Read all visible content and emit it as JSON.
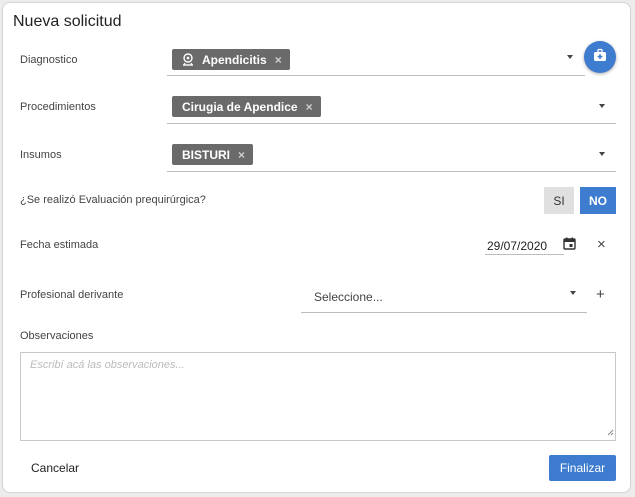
{
  "dialog": {
    "title": "Nueva solicitud"
  },
  "diagnostico": {
    "label": "Diagnostico",
    "chip": "Apendicitis",
    "chip_icon": "person-pin-icon",
    "remove": "×",
    "add_button_icon": "medical-kit-add-icon"
  },
  "procedimientos": {
    "label": "Procedimientos",
    "chip": "Cirugia de Apendice",
    "remove": "×"
  },
  "insumos": {
    "label": "Insumos",
    "chip": "BISTURI",
    "remove": "×"
  },
  "evaluacion": {
    "label": "¿Se realizó Evaluación prequirúrgica?",
    "yes": "SI",
    "no": "NO",
    "selected": "NO"
  },
  "fecha": {
    "label": "Fecha estimada",
    "value": "29/07/2020",
    "clear": "×"
  },
  "profesional": {
    "label": "Profesional derivante",
    "placeholder": "Seleccione...",
    "add": "+"
  },
  "observaciones": {
    "label": "Observaciones",
    "placeholder": "Escribí acá las observaciones..."
  },
  "footer": {
    "cancel": "Cancelar",
    "submit": "Finalizar"
  },
  "colors": {
    "accent": "#3e7ccf",
    "chip": "#6a6a6a"
  }
}
